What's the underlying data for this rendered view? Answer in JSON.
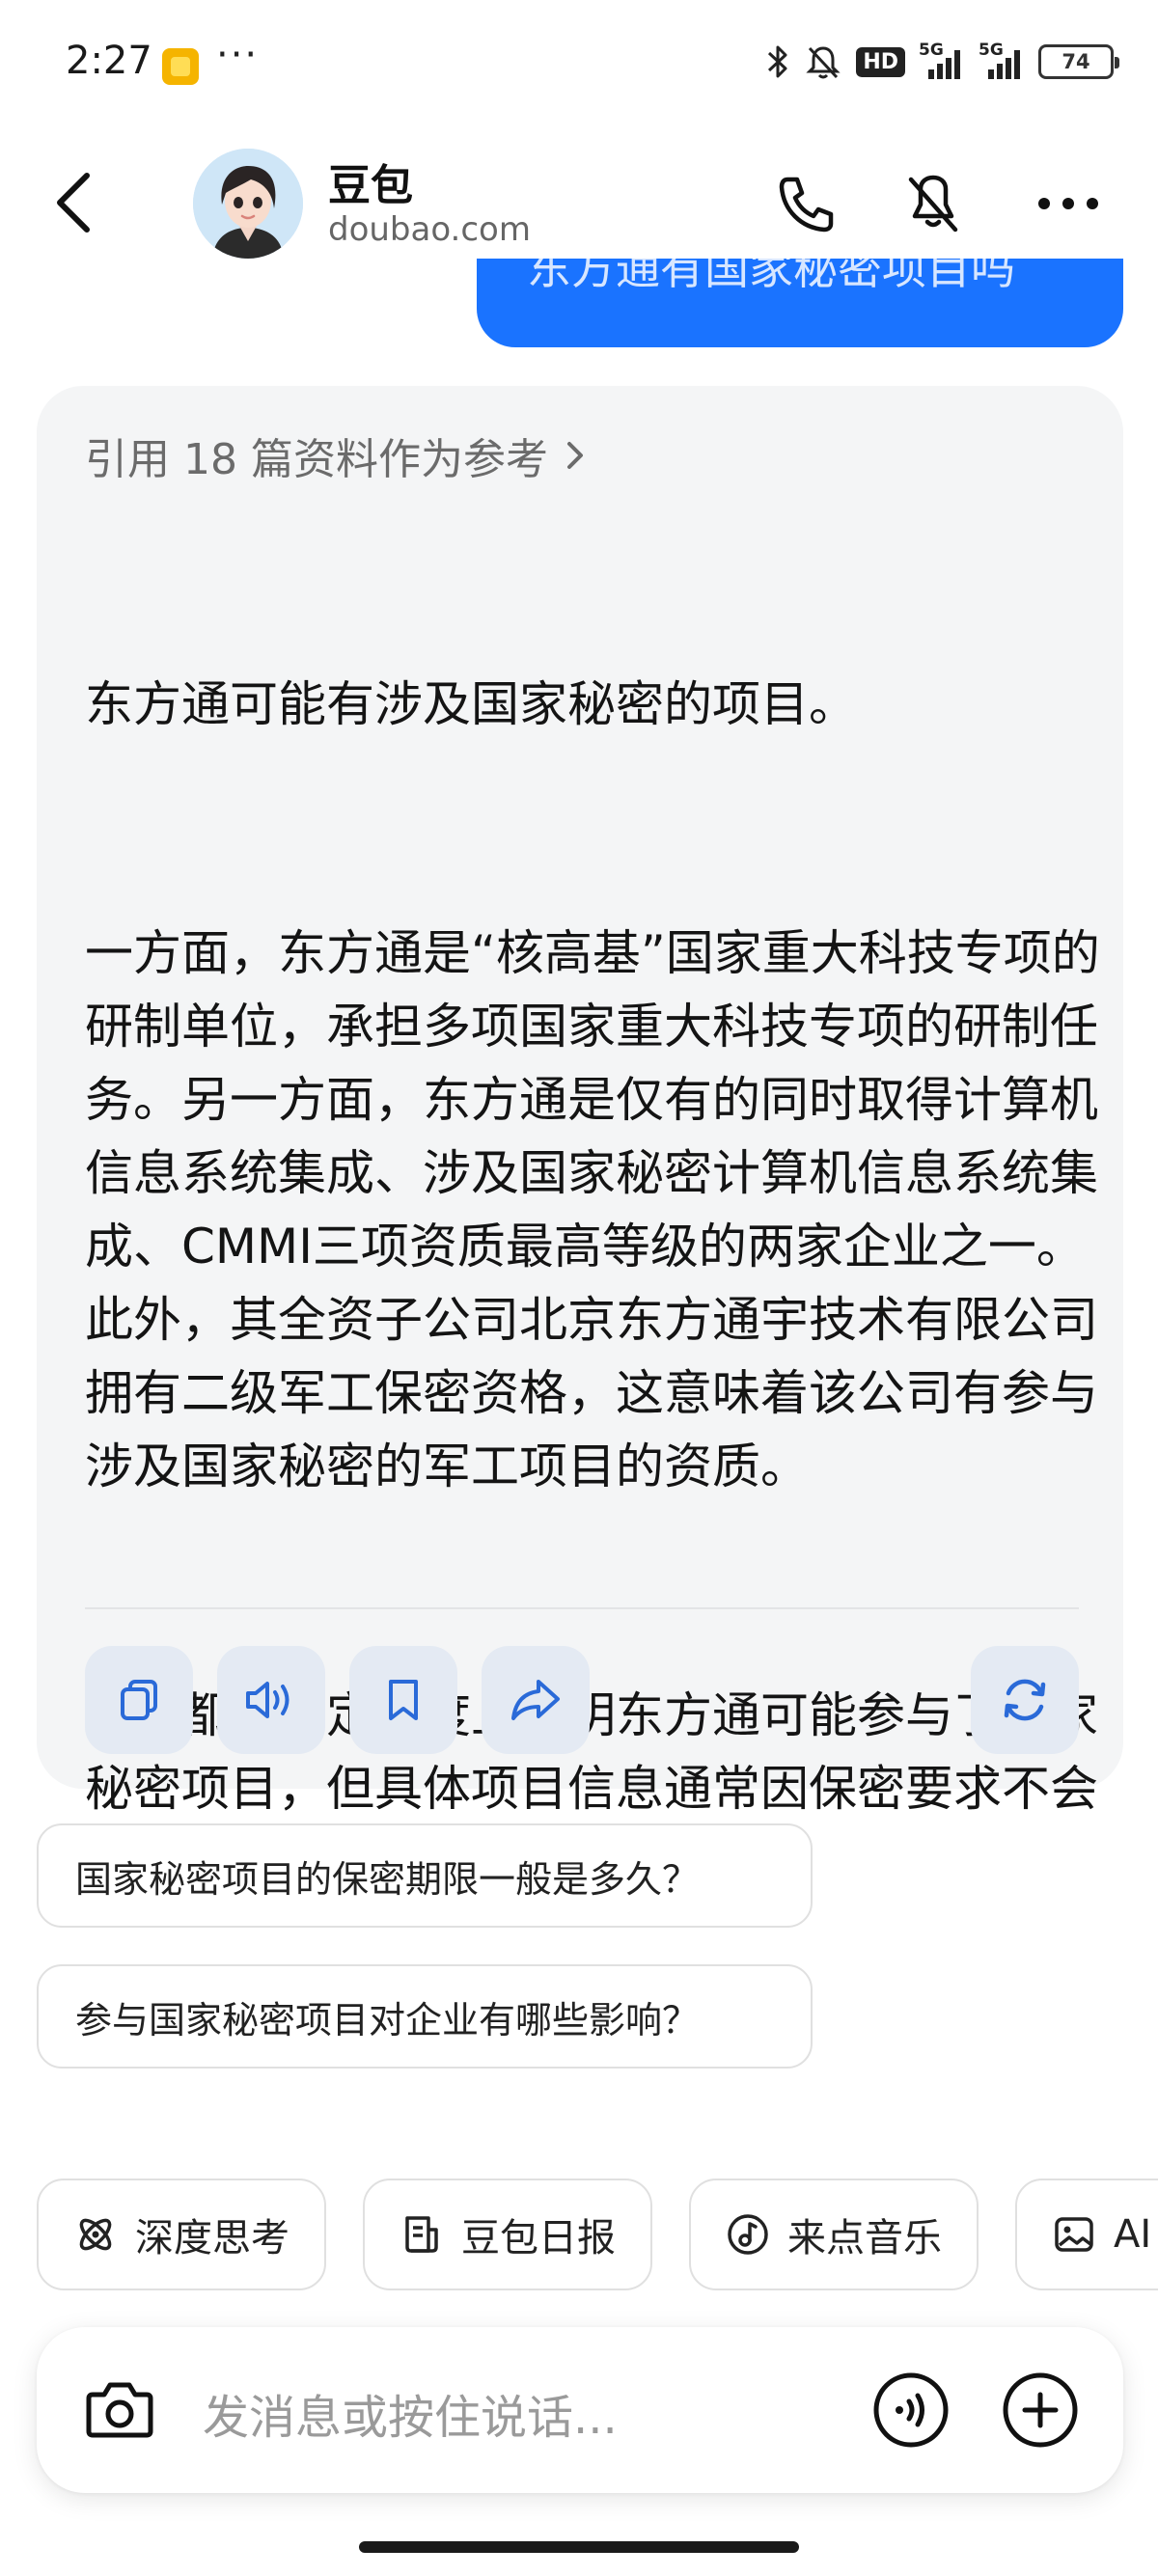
{
  "status_bar": {
    "time": "2:27",
    "dots": "···",
    "hd_label": "HD",
    "signal1_label": "5G",
    "signal2_label": "5G",
    "battery": "74"
  },
  "header": {
    "title": "豆包",
    "subtitle": "doubao.com",
    "icons": [
      "back-icon",
      "phone-icon",
      "speaker-muted-icon",
      "more-icon"
    ]
  },
  "user_message": {
    "text": "东方通有国家秘密项目吗"
  },
  "answer": {
    "reference_label": "引用 18 篇资料作为参考",
    "paragraphs": [
      "东方通可能有涉及国家秘密的项目。",
      "一方面，东方通是“核高基”国家重大科技专项的研制单位，承担多项国家重大科技专项的研制任务。另一方面，东方通是仅有的同时取得计算机信息系统集成、涉及国家秘密计算机信息系统集成、CMMI三项资质最高等级的两家企业之一。此外，其全资子公司北京东方通宇技术有限公司拥有二级军工保密资格，这意味着该公司有参与涉及国家秘密的军工项目的资质。",
      "这些都在一定程度上表明东方通可能参与了国家秘密项目，但具体项目信息通常因保密要求不会对外公开披露。"
    ],
    "actions": [
      "copy-icon",
      "read-aloud-icon",
      "bookmark-icon",
      "share-icon",
      "regenerate-icon"
    ]
  },
  "suggestions": [
    "国家秘密项目的保密期限一般是多久？",
    "参与国家秘密项目对企业有哪些影响？"
  ],
  "chips": [
    {
      "label": "深度思考",
      "icon": "atom-icon"
    },
    {
      "label": "豆包日报",
      "icon": "newspaper-icon"
    },
    {
      "label": "来点音乐",
      "icon": "music-icon"
    },
    {
      "label": "AI",
      "icon": "image-icon"
    }
  ],
  "input": {
    "placeholder": "发消息或按住说话..."
  },
  "colors": {
    "accent": "#1a73ff",
    "card_bg": "#f4f5f6",
    "action_bg": "#e4eaf3",
    "action_icon": "#2a6ad8"
  }
}
